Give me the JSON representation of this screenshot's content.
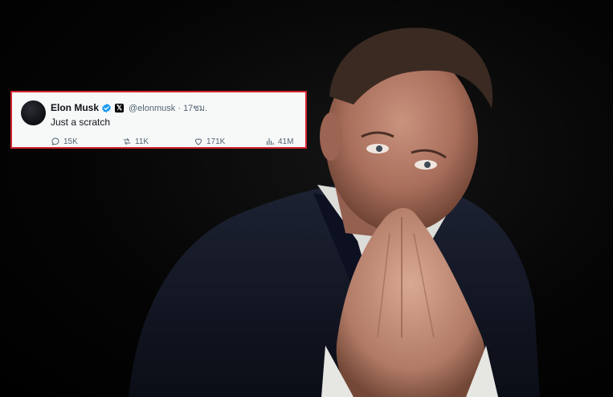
{
  "tweet": {
    "author_name": "Elon Musk",
    "handle": "@elonmusk",
    "separator": "·",
    "time": "17ชม.",
    "text": "Just a scratch",
    "badge_letter": "𝕏",
    "stats": {
      "replies": "15K",
      "reposts": "11K",
      "likes": "171K",
      "views": "41M"
    },
    "icons": [
      "reply-icon",
      "repost-icon",
      "like-icon",
      "views-icon",
      "verified-icon",
      "x-logo-icon"
    ],
    "colors": {
      "frame": "#d2252f",
      "verified": "#1d9bf0",
      "card_bg": "#f7f9f9"
    }
  }
}
